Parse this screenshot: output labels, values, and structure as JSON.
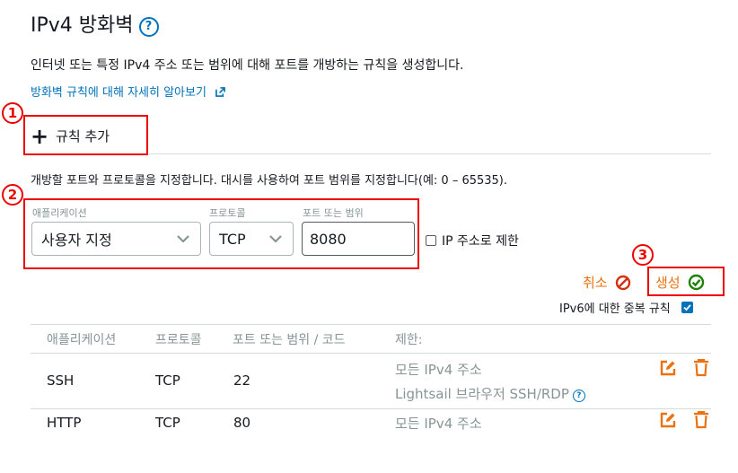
{
  "header": {
    "title": "IPv4 방화벽",
    "description": "인터넷 또는 특정 IPv4 주소 또는 범위에 대해 포트를 개방하는 규칙을 생성합니다.",
    "learn_more": "방화벽 규칙에 대해 자세히 알아보기"
  },
  "markers": {
    "m1": "1",
    "m2": "2",
    "m3": "3"
  },
  "add_rule": {
    "label": "규칙 추가"
  },
  "hint": "개방할 포트와 프로토콜을 지정합니다. 대시를 사용하여 포트 범위를 지정합니다(예: 0 – 65535).",
  "form": {
    "application_label": "애플리케이션",
    "application_value": "사용자 지정",
    "protocol_label": "프로토콜",
    "protocol_value": "TCP",
    "port_label": "포트 또는 범위",
    "port_value": "8080",
    "restrict_label": "IP 주소로 제한",
    "cancel_label": "취소",
    "create_label": "생성",
    "dup_label": "IPv6에 대한 중복 규칙",
    "dup_checked": true
  },
  "table": {
    "headers": [
      "애플리케이션",
      "프로토콜",
      "포트 또는 범위 / 코드",
      "제한:"
    ],
    "rows": [
      {
        "app": "SSH",
        "protocol": "TCP",
        "port": "22",
        "restrict": "모든 IPv4 주소",
        "restrict2": "Lightsail 브라우저 SSH/RDP"
      },
      {
        "app": "HTTP",
        "protocol": "TCP",
        "port": "80",
        "restrict": "모든 IPv4 주소"
      }
    ]
  },
  "colors": {
    "accent": "#ec7211",
    "link": "#0073bb",
    "marker": "#ee0000",
    "create_icon": "#1d8102"
  }
}
